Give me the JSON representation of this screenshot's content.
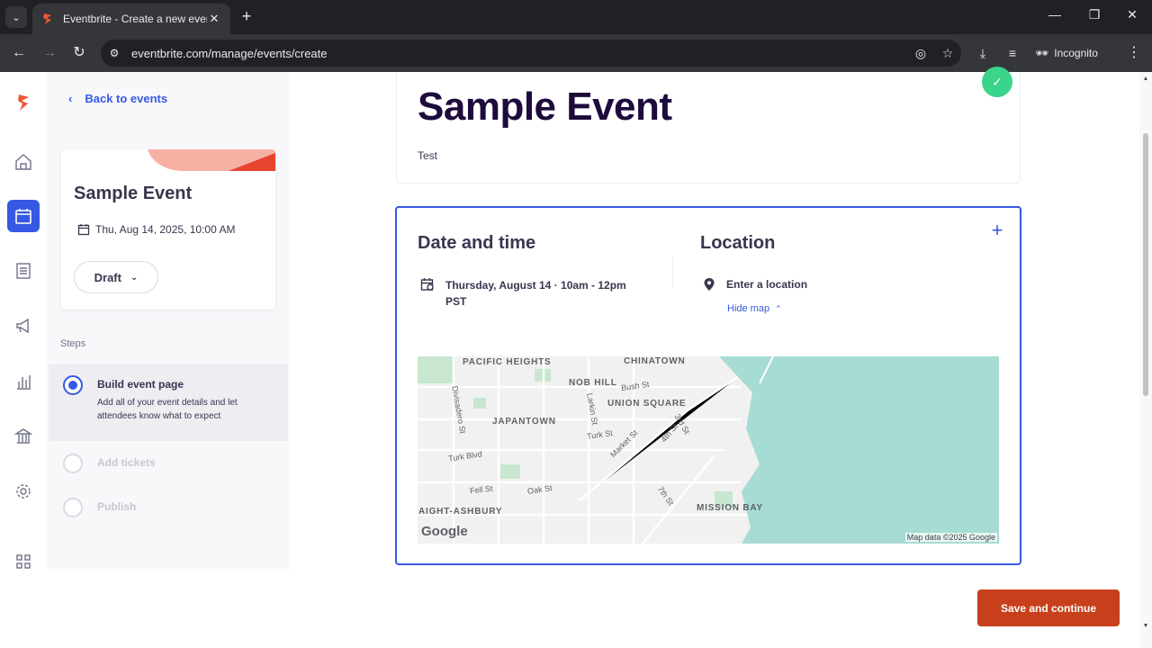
{
  "browser": {
    "tab_title": "Eventbrite - Create a new event",
    "url": "eventbrite.com/manage/events/create",
    "incognito_label": "Incognito"
  },
  "sidebar": {
    "back_label": "Back to events",
    "event_title": "Sample Event",
    "event_date": "Thu, Aug 14, 2025, 10:00 AM",
    "status_label": "Draft",
    "steps_label": "Steps",
    "steps": [
      {
        "title": "Build event page",
        "description": "Add all of your event details and let attendees know what to expect"
      },
      {
        "title": "Add tickets"
      },
      {
        "title": "Publish"
      }
    ]
  },
  "main": {
    "title": "Sample Event",
    "summary": "Test",
    "datetime": {
      "heading": "Date and time",
      "value": "Thursday, August 14 · 10am - 12pm PST"
    },
    "location": {
      "heading": "Location",
      "value": "Enter a location",
      "hide_map_label": "Hide map"
    },
    "map": {
      "neighborhoods": [
        "PACIFIC HEIGHTS",
        "CHINATOWN",
        "NOB HILL",
        "UNION SQUARE",
        "JAPANTOWN",
        "MISSION BAY",
        "AIGHT-ASHBURY"
      ],
      "streets": [
        "Divisadero St",
        "Bush St",
        "Larkin St",
        "Turk St",
        "Market St",
        "3rd St",
        "4th St",
        "Turk Blvd",
        "Fell St",
        "Oak St",
        "7th St"
      ],
      "logo": "Google",
      "attribution": "Map data ©2025 Google"
    },
    "save_label": "Save and continue"
  },
  "colors": {
    "accent": "#3659e3",
    "brand": "#f05537",
    "save_button": "#c8401b",
    "success": "#3ad48a"
  }
}
